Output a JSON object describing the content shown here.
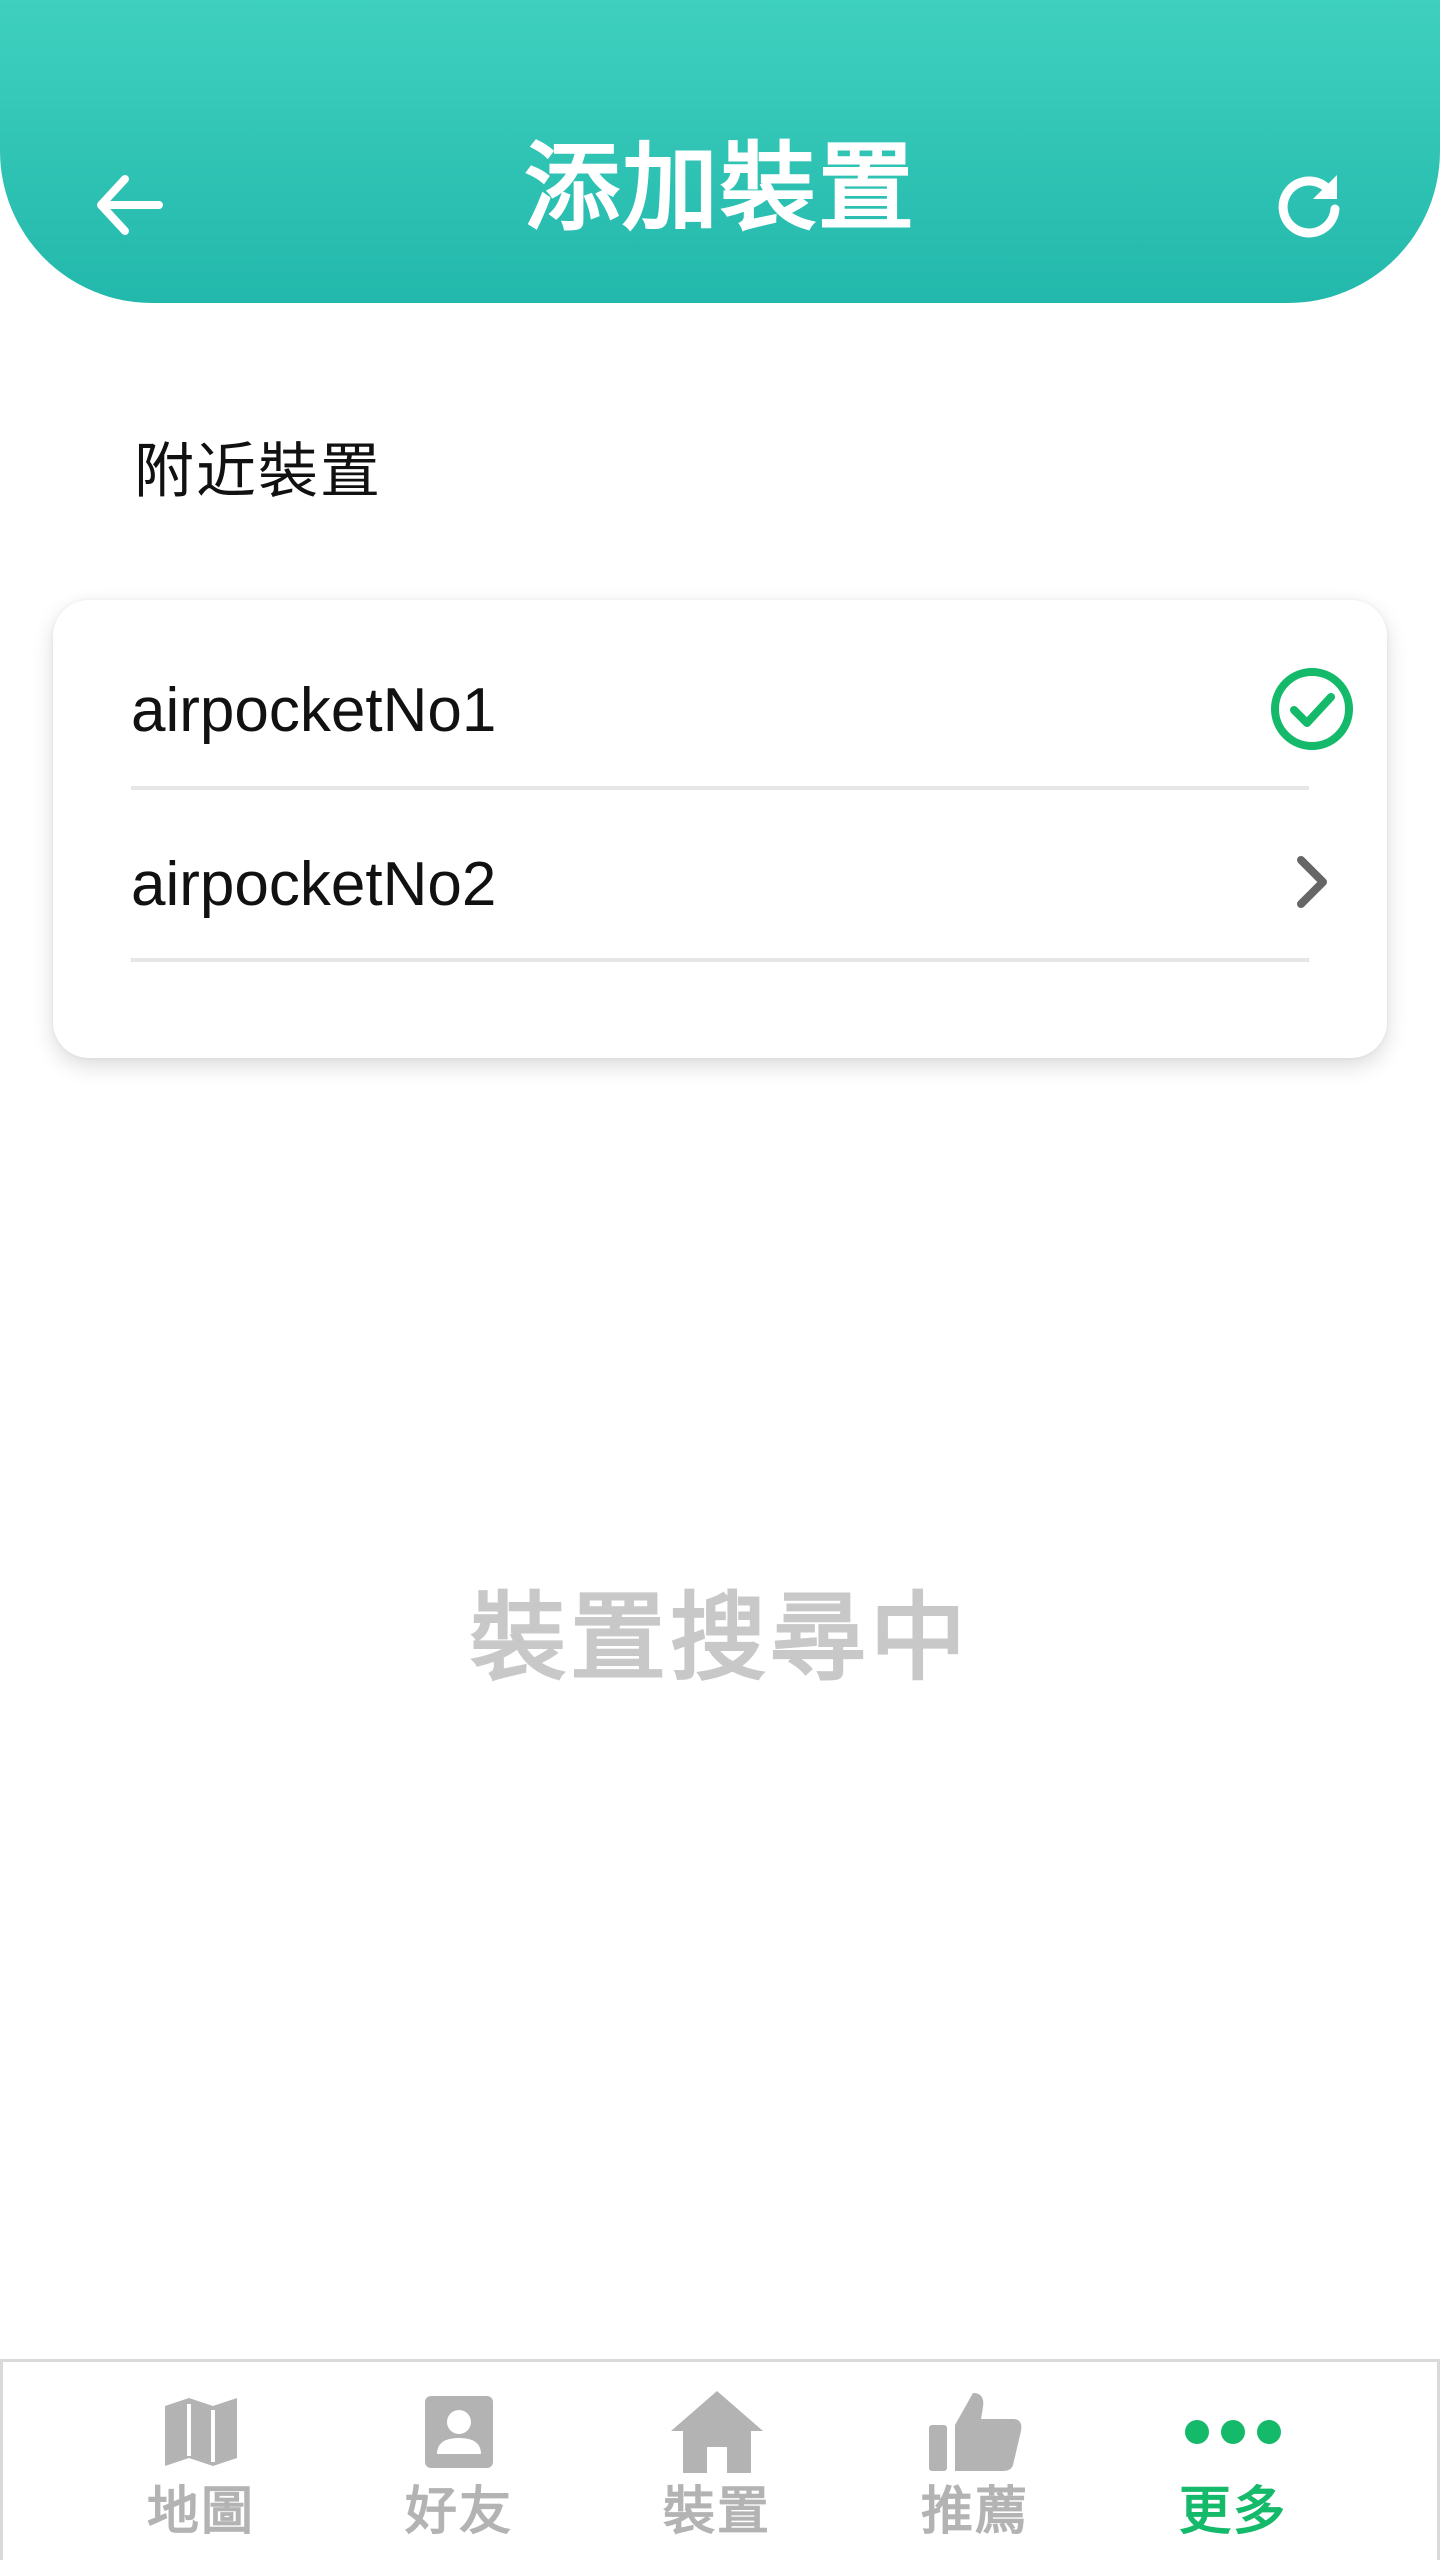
{
  "header": {
    "title": "添加裝置",
    "back_icon": "arrow-left-icon",
    "refresh_icon": "refresh-icon"
  },
  "section": {
    "label": "附近裝置"
  },
  "devices": [
    {
      "name": "airpocketNo1",
      "status": "connected",
      "icon": "check-circle-icon"
    },
    {
      "name": "airpocketNo2",
      "status": "available",
      "icon": "chevron-right-icon"
    }
  ],
  "status": {
    "searching_text": "裝置搜尋中"
  },
  "bottom_nav": {
    "items": [
      {
        "label": "地圖",
        "icon": "map-icon",
        "active": false
      },
      {
        "label": "好友",
        "icon": "contact-icon",
        "active": false
      },
      {
        "label": "裝置",
        "icon": "home-icon",
        "active": false
      },
      {
        "label": "推薦",
        "icon": "thumbs-up-icon",
        "active": false
      },
      {
        "label": "更多",
        "icon": "more-dots-icon",
        "active": true
      }
    ]
  },
  "colors": {
    "header_gradient_top": "#3fd0bf",
    "header_gradient_bottom": "#22b8ab",
    "accent_green": "#14b96a",
    "inactive_gray": "#b3b3b3",
    "searching_gray": "#c8c8c8"
  }
}
